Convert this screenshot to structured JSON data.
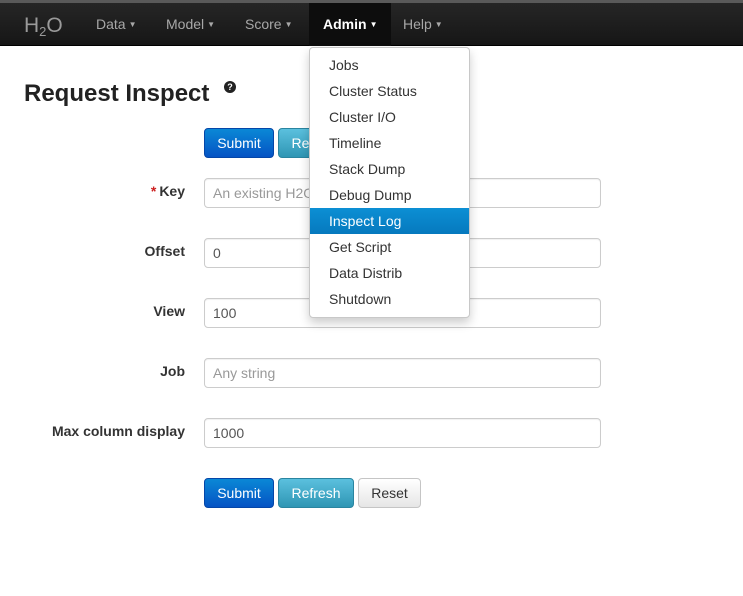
{
  "navbar": {
    "brand": {
      "main": "H",
      "sub": "2",
      "tail": "O"
    },
    "items": [
      {
        "label": "Data"
      },
      {
        "label": "Model"
      },
      {
        "label": "Score"
      },
      {
        "label": "Admin"
      },
      {
        "label": "Help"
      }
    ],
    "active": "Admin"
  },
  "page": {
    "title": "Request Inspect",
    "help_icon": "question-icon"
  },
  "top_buttons": {
    "submit": "Submit",
    "refresh": "Refresh"
  },
  "form": {
    "key": {
      "label": "Key",
      "required_mark": "*",
      "placeholder": "An existing H2O key",
      "value": ""
    },
    "offset": {
      "label": "Offset",
      "value": "0"
    },
    "view": {
      "label": "View",
      "value": "100"
    },
    "job": {
      "label": "Job",
      "placeholder": "Any string",
      "value": ""
    },
    "max_column_display": {
      "label": "Max column display",
      "value": "1000"
    }
  },
  "bottom_buttons": {
    "submit": "Submit",
    "refresh": "Refresh",
    "reset": "Reset"
  },
  "admin_menu": {
    "items": [
      "Jobs",
      "Cluster Status",
      "Cluster I/O",
      "Timeline",
      "Stack Dump",
      "Debug Dump",
      "Inspect Log",
      "Get Script",
      "Data Distrib",
      "Shutdown"
    ],
    "highlighted": "Inspect Log"
  },
  "colors": {
    "navbar": "#1b1b1b",
    "primary": "#0553c4",
    "info": "#2f96b4",
    "highlight": "#0679be",
    "required": "#cc1f1f"
  }
}
